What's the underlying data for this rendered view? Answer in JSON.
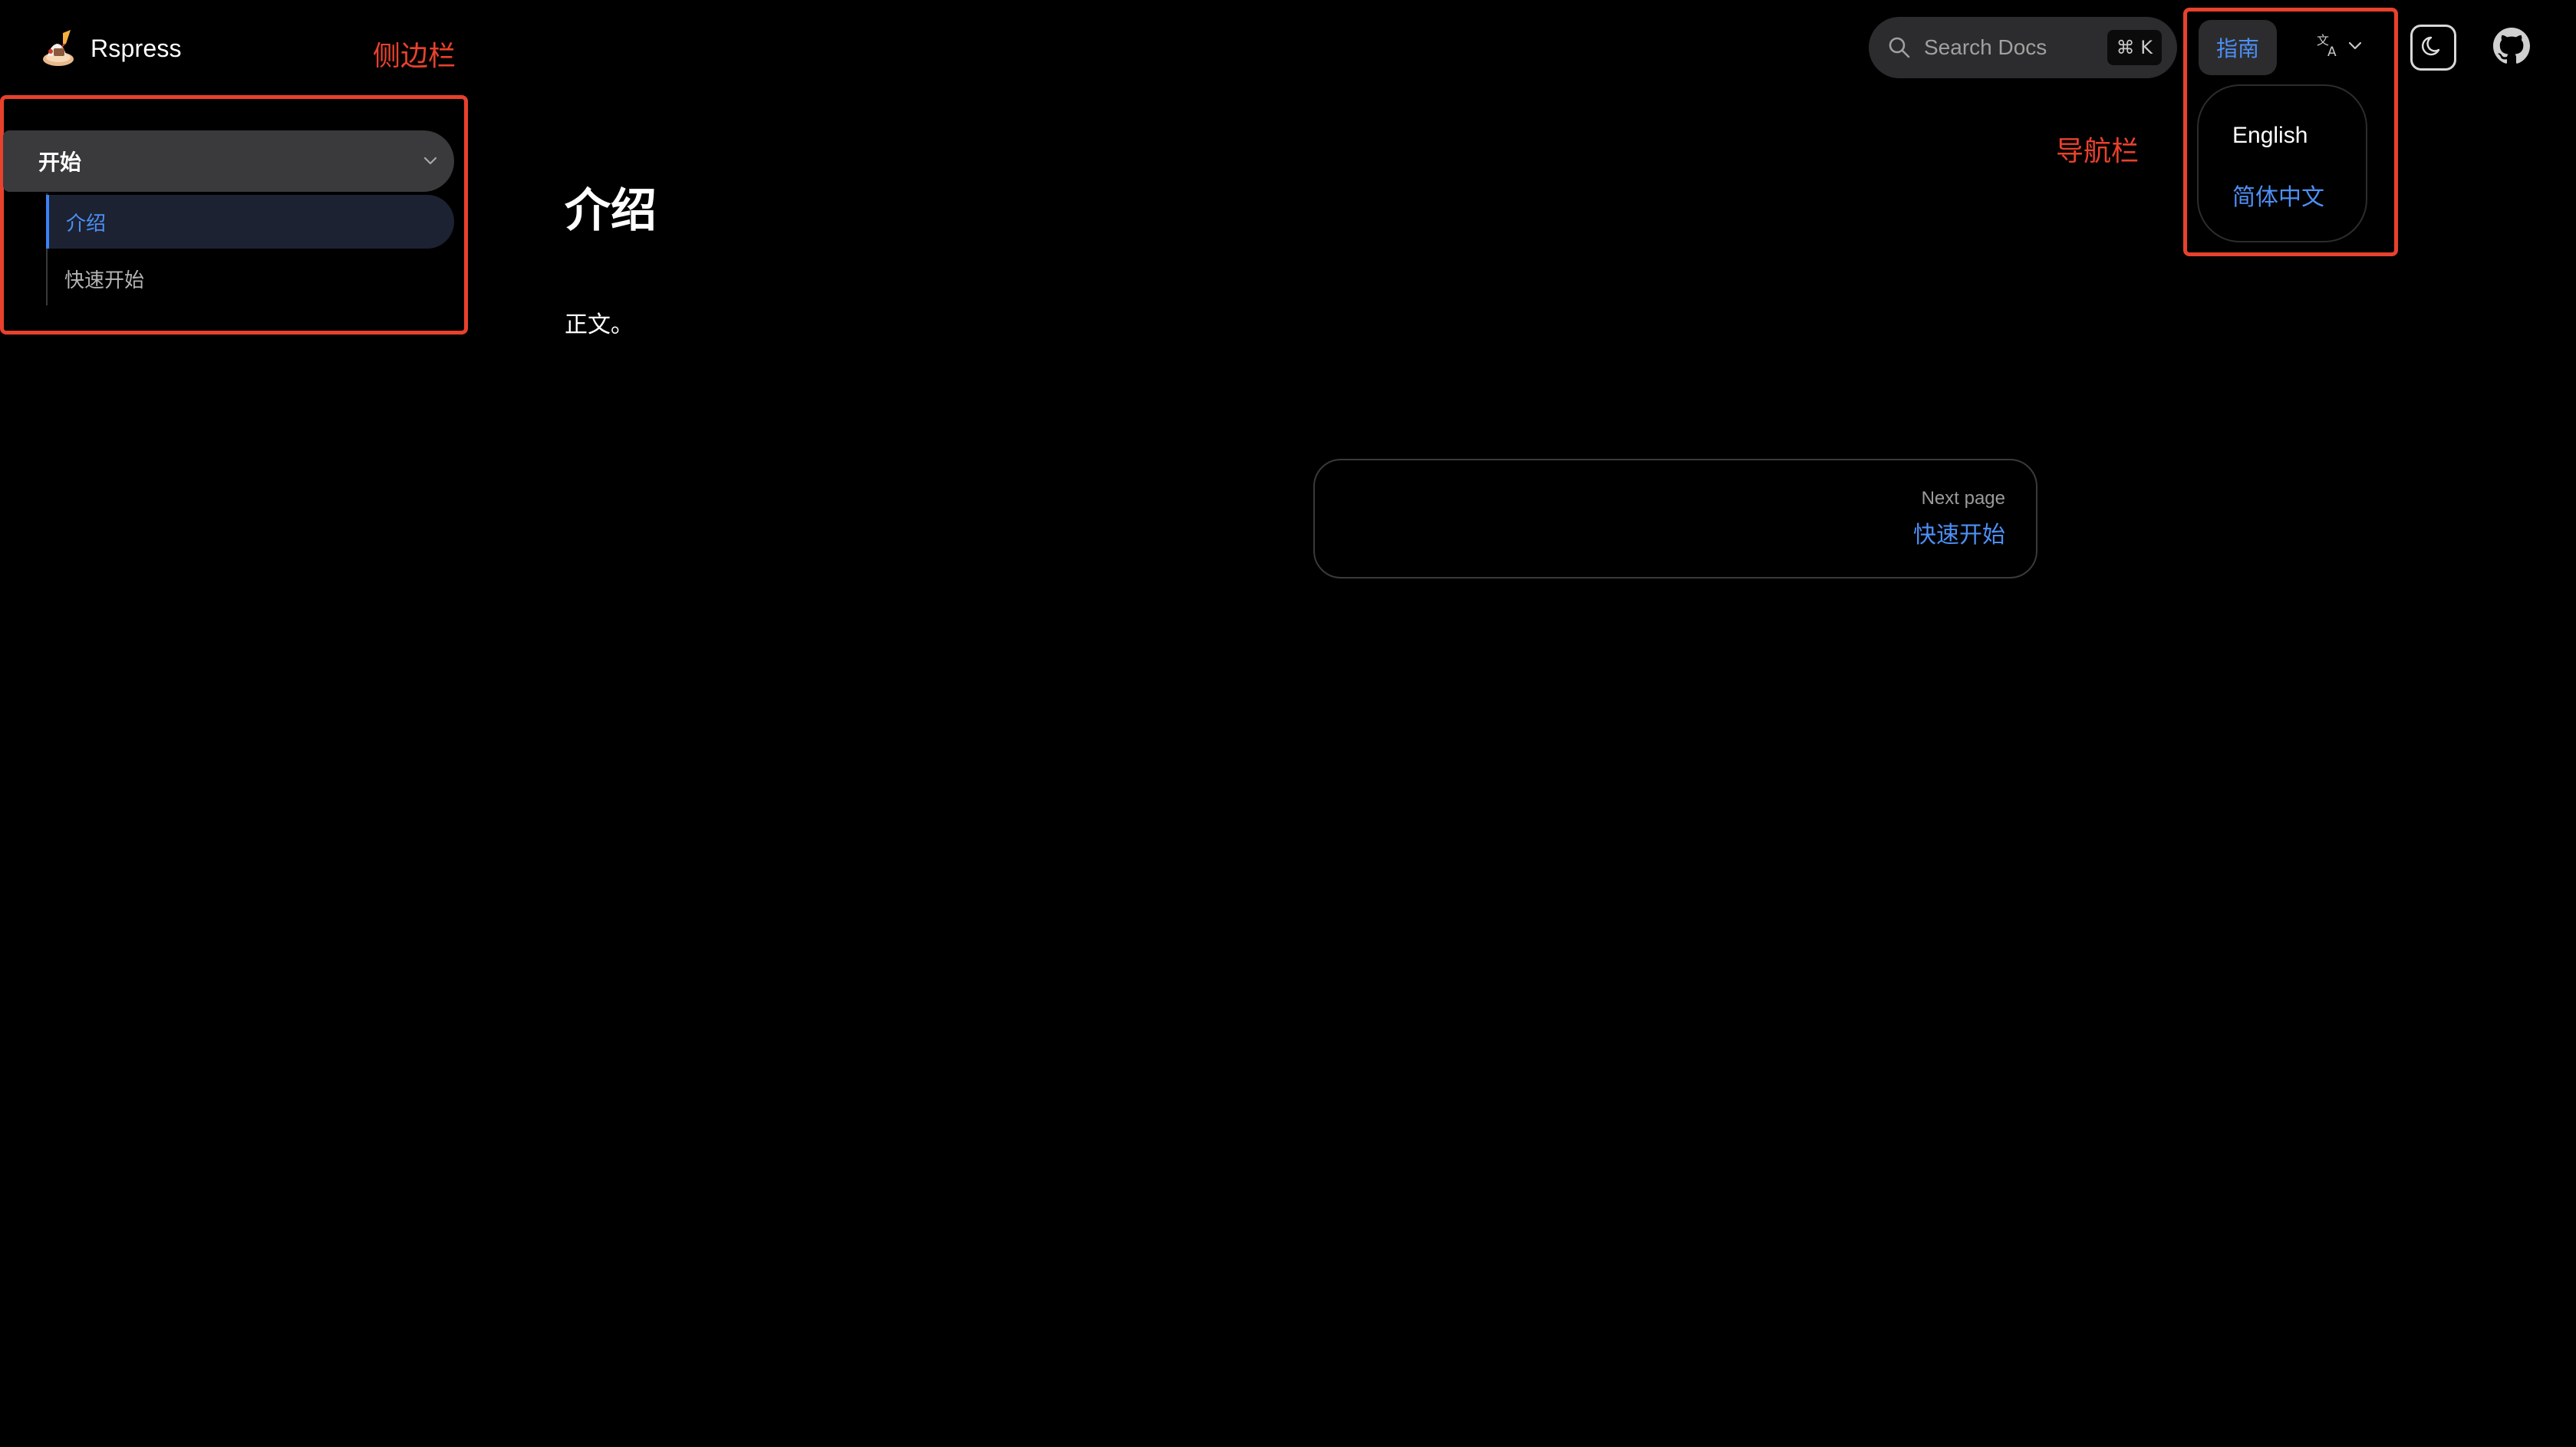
{
  "brand": {
    "name": "Rspress",
    "logo_icon": "rspress-logo-icon"
  },
  "annotations": {
    "sidebar_label": "侧边栏",
    "navbar_label": "导航栏",
    "color": "#e8412c"
  },
  "sidebar": {
    "group_title": "开始",
    "items": [
      {
        "label": "介绍",
        "active": true
      },
      {
        "label": "快速开始",
        "active": false
      }
    ]
  },
  "main": {
    "title": "介绍",
    "body": "正文。",
    "next_page": {
      "label": "Next page",
      "title": "快速开始"
    }
  },
  "nav": {
    "search": {
      "placeholder": "Search Docs",
      "shortcut": "⌘ K"
    },
    "guide_label": "指南",
    "language": {
      "icon": "translate-icon",
      "options": [
        {
          "label": "English",
          "selected": false
        },
        {
          "label": "简体中文",
          "selected": true
        }
      ]
    },
    "theme_icon": "moon-icon",
    "github_icon": "github-icon"
  },
  "colors": {
    "background": "#000000",
    "accent": "#4d8ff5",
    "panel": "#2c2c2e"
  }
}
